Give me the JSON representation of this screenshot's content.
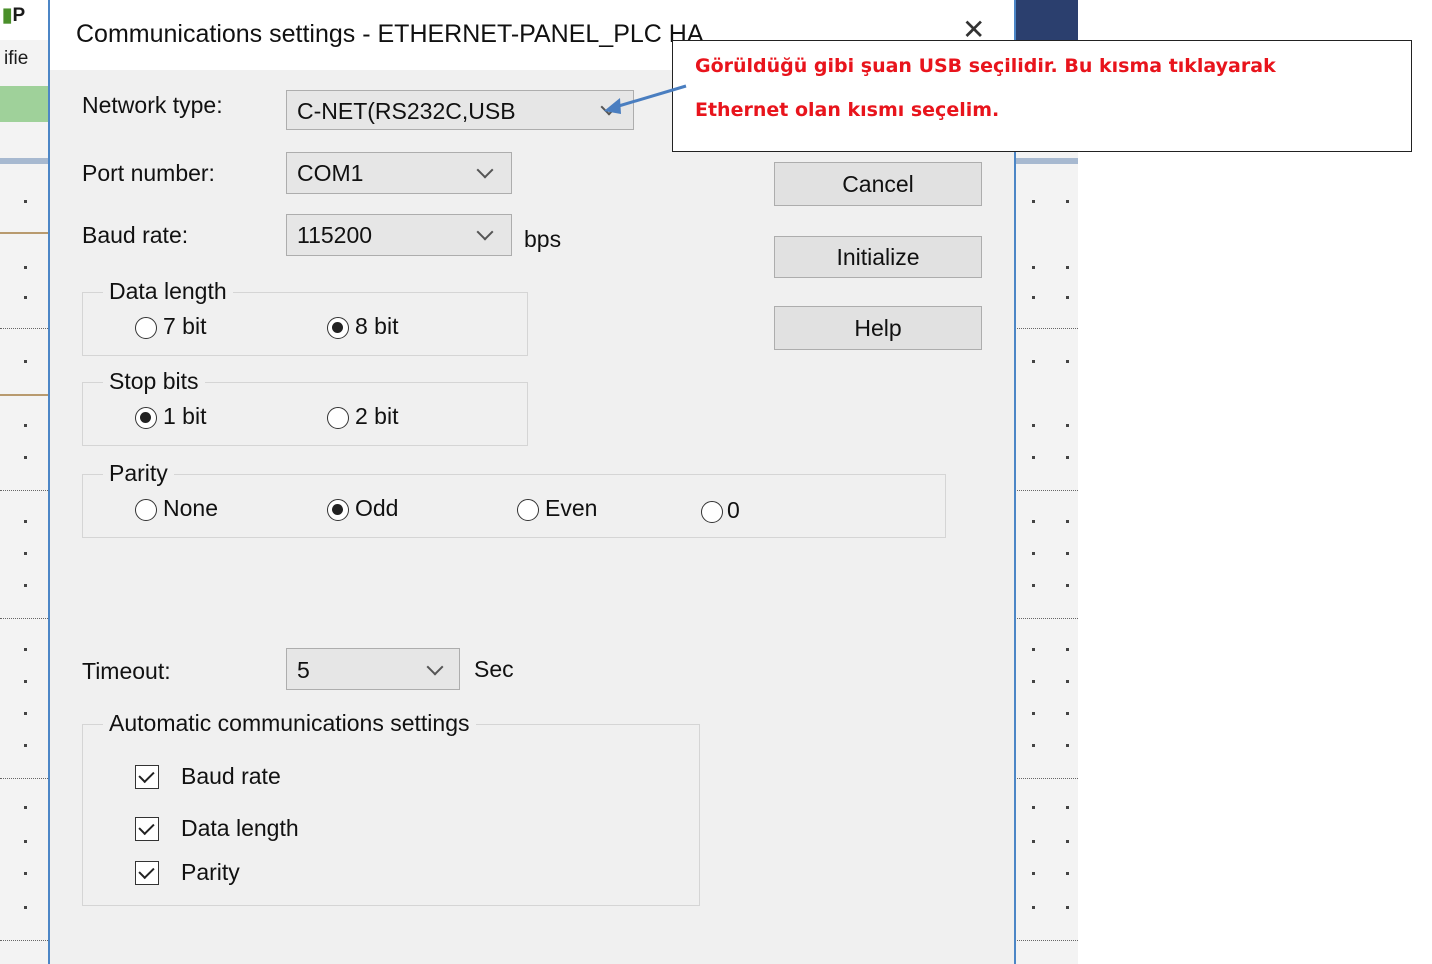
{
  "background_app": {
    "title_fragment": "P",
    "menu_fragment": "ifie"
  },
  "dialog": {
    "title": "Communications settings - ETHERNET-PANEL_PLC HA",
    "close_glyph": "✕",
    "network_type": {
      "label": "Network type:",
      "value": "C-NET(RS232C,USB"
    },
    "port_number": {
      "label": "Port number:",
      "value": "COM1"
    },
    "baud_rate": {
      "label": "Baud rate:",
      "value": "115200",
      "unit": "bps"
    },
    "buttons": {
      "cancel": "Cancel",
      "initialize": "Initialize",
      "help": "Help"
    },
    "data_length": {
      "title": "Data length",
      "options": [
        {
          "label": "7 bit",
          "selected": false
        },
        {
          "label": "8 bit",
          "selected": true
        }
      ]
    },
    "stop_bits": {
      "title": "Stop bits",
      "options": [
        {
          "label": "1 bit",
          "selected": true
        },
        {
          "label": "2 bit",
          "selected": false
        }
      ]
    },
    "parity": {
      "title": "Parity",
      "options": [
        {
          "label": "None",
          "selected": false
        },
        {
          "label": "Odd",
          "selected": true
        },
        {
          "label": "Even",
          "selected": false
        },
        {
          "label": "0",
          "selected": false
        }
      ]
    },
    "timeout": {
      "label": "Timeout:",
      "value": "5",
      "unit": "Sec"
    },
    "auto_settings": {
      "title": "Automatic communications settings",
      "items": [
        {
          "label": "Baud rate",
          "checked": true
        },
        {
          "label": "Data length",
          "checked": true
        },
        {
          "label": "Parity",
          "checked": true
        }
      ]
    }
  },
  "annotation": {
    "line1": "Görüldüğü gibi şuan USB seçilidir. Bu kısma tıklayarak",
    "line2": "Ethernet olan kısmı seçelim.",
    "text_color": "#e8141c",
    "arrow_color": "#4a7ec0"
  },
  "colors": {
    "dialog_border": "#4c86c6",
    "dialog_bg": "#f0f0f0"
  }
}
